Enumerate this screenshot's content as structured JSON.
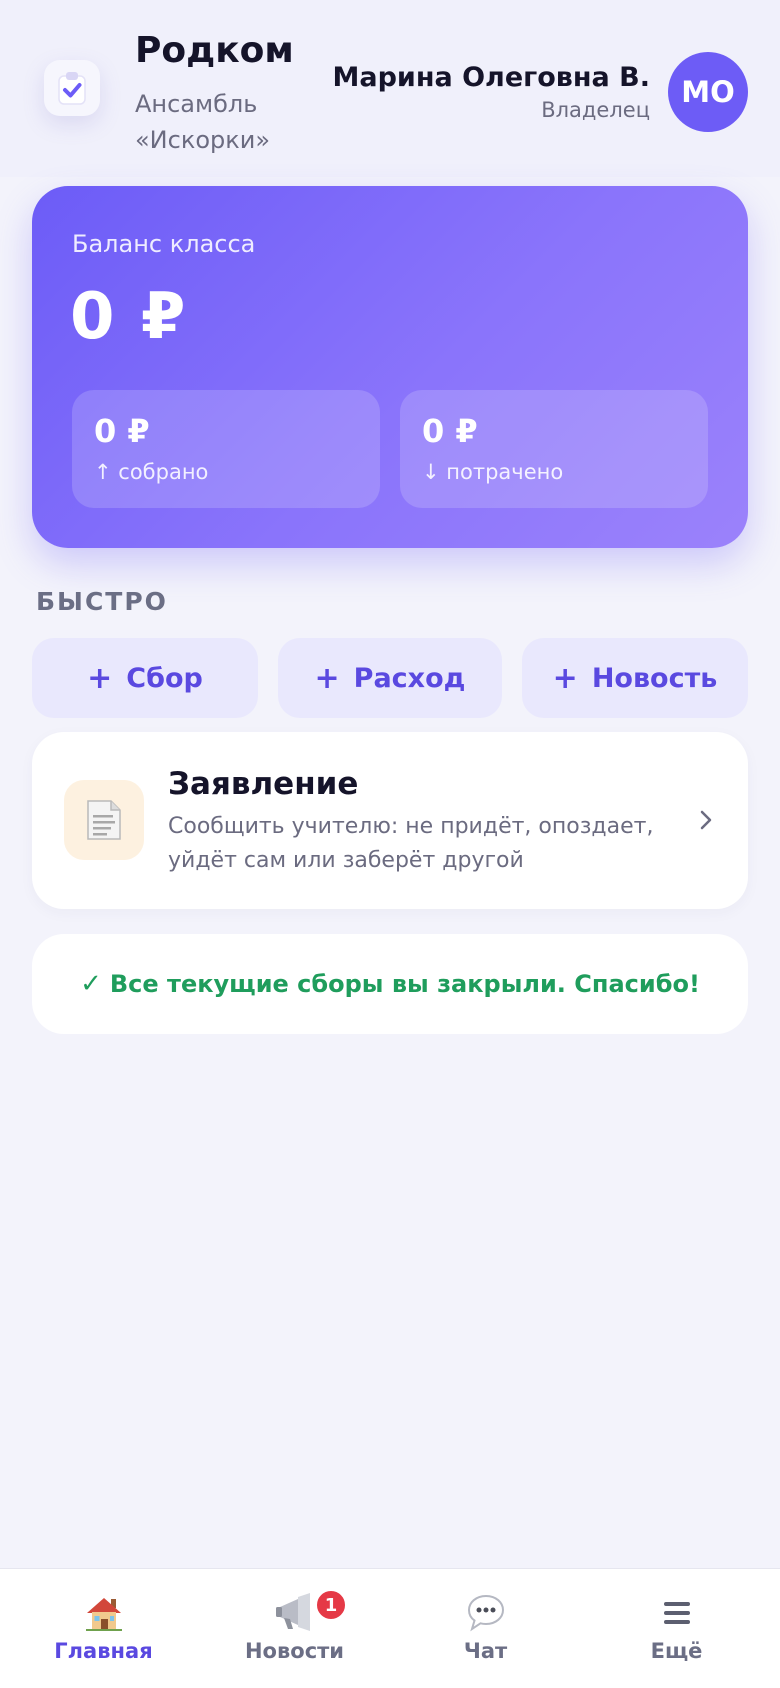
{
  "header": {
    "app_title": "Родком",
    "app_subtitle": "Ансамбль «Искорки»",
    "user_name": "Марина Олеговна В.",
    "user_role": "Владелец",
    "avatar_initials": "МО"
  },
  "balance": {
    "label": "Баланс класса",
    "value": "0 ₽",
    "collected_value": "0 ₽",
    "collected_label": "↑ собрано",
    "spent_value": "0 ₽",
    "spent_label": "↓ потрачено"
  },
  "quick": {
    "title": "БЫСТРО",
    "actions": [
      {
        "plus": "+",
        "label": "Сбор"
      },
      {
        "plus": "+",
        "label": "Расход"
      },
      {
        "plus": "+",
        "label": "Новость"
      }
    ]
  },
  "statement": {
    "title": "Заявление",
    "description": "Сообщить учителю: не придёт, опоздает, уйдёт сам или заберёт другой",
    "icon": "document-icon"
  },
  "success": {
    "check": "✓",
    "text": "Все текущие сборы вы закрыли. Спасибо!"
  },
  "nav": {
    "items": [
      {
        "label": "Главная",
        "icon": "home-icon",
        "active": true
      },
      {
        "label": "Новости",
        "icon": "megaphone-icon",
        "badge": "1"
      },
      {
        "label": "Чат",
        "icon": "chat-bubble-icon"
      },
      {
        "label": "Ещё",
        "icon": "menu-icon"
      }
    ]
  },
  "colors": {
    "accent": "#6c5cf7",
    "accent_text": "#5a49e0",
    "success": "#1f9d5c",
    "badge": "#e53946",
    "background": "#f3f3fb"
  }
}
